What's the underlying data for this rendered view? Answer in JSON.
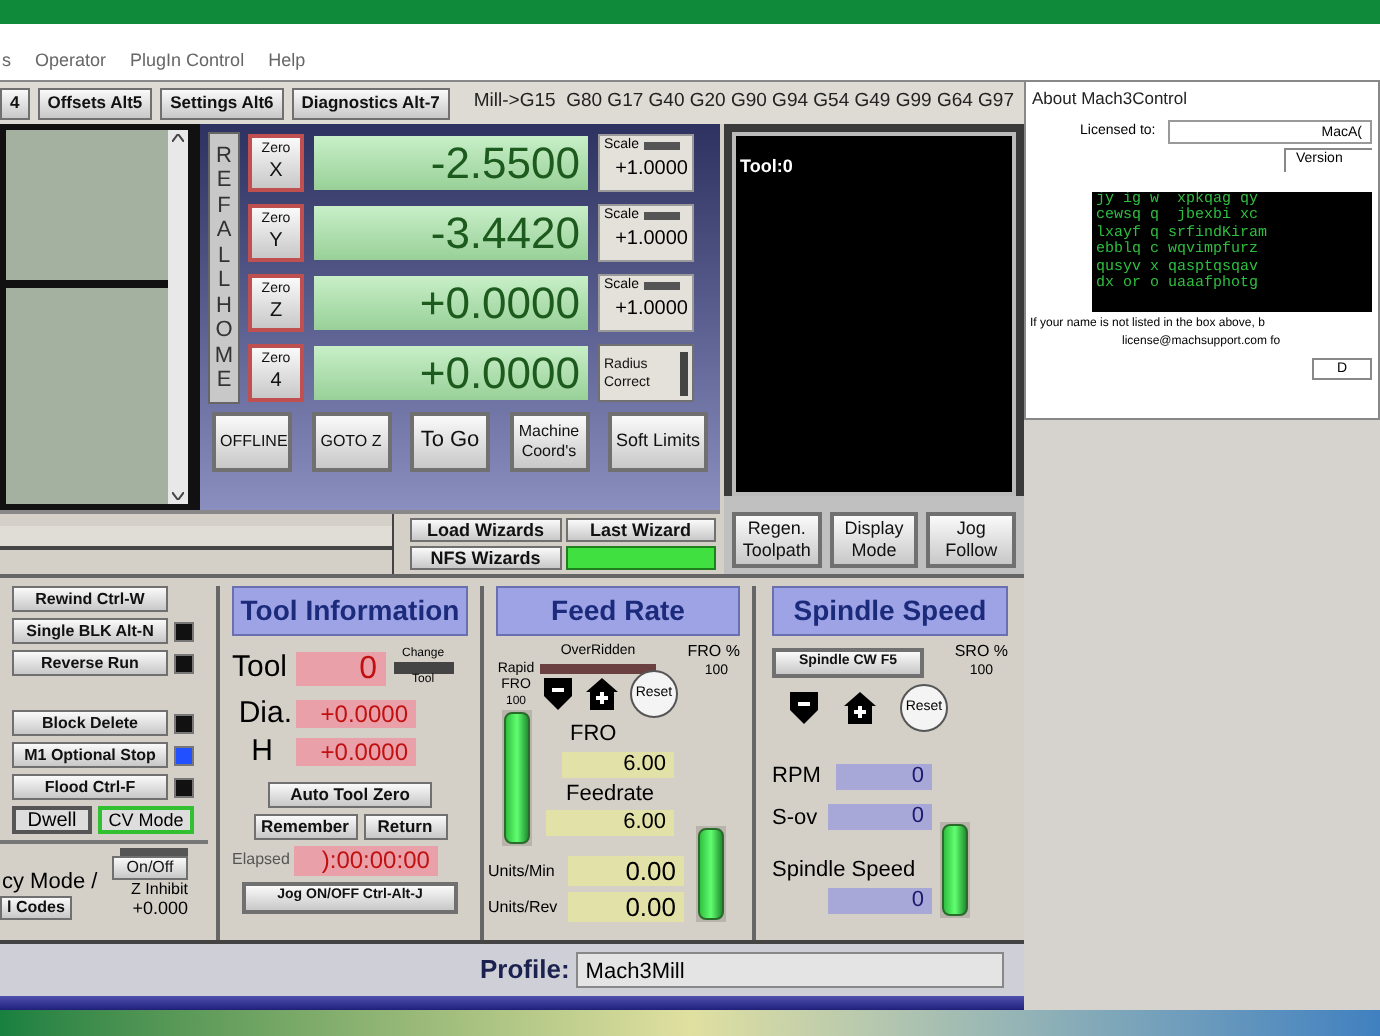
{
  "menu": [
    "s",
    "Operator",
    "PlugIn Control",
    "Help"
  ],
  "tabs": [
    {
      "label": "4",
      "selected": false
    },
    {
      "label": "Offsets Alt5",
      "selected": false
    },
    {
      "label": "Settings Alt6",
      "selected": false
    },
    {
      "label": "Diagnostics Alt-7",
      "selected": false
    }
  ],
  "modal_line": "Mill->G15  G80 G17 G40 G20 G90 G94 G54 G49 G99 G64 G97",
  "ref_all_home": "REFALLHOME",
  "axes": [
    {
      "zero_label": "Zero",
      "axis": "X",
      "value": "-2.5500",
      "side": {
        "kind": "scale",
        "label": "Scale",
        "value": "+1.0000"
      }
    },
    {
      "zero_label": "Zero",
      "axis": "Y",
      "value": "-3.4420",
      "side": {
        "kind": "scale",
        "label": "Scale",
        "value": "+1.0000"
      }
    },
    {
      "zero_label": "Zero",
      "axis": "Z",
      "value": "+0.0000",
      "side": {
        "kind": "scale",
        "label": "Scale",
        "value": "+1.0000"
      }
    },
    {
      "zero_label": "Zero",
      "axis": "4",
      "value": "+0.0000",
      "side": {
        "kind": "radius",
        "label": "Radius Correct"
      }
    }
  ],
  "dro_buttons": [
    "OFFLINE",
    "GOTO Z",
    "To Go",
    "Machine Coord's",
    "Soft Limits"
  ],
  "toolpath": {
    "label": "Tool:0",
    "buttons": [
      "Regen. Toolpath",
      "Display Mode",
      "Jog Follow"
    ]
  },
  "wizards": [
    "Load Wizards",
    "Last Wizard",
    "NFS Wizards"
  ],
  "left_buttons": [
    {
      "label": "Rewind Ctrl-W",
      "kind": "plain"
    },
    {
      "label": "Single BLK Alt-N",
      "kind": "led",
      "on": false
    },
    {
      "label": "Reverse Run",
      "kind": "led",
      "on": false
    },
    {
      "label": "Block Delete",
      "kind": "led",
      "on": false
    },
    {
      "label": "M1 Optional Stop",
      "kind": "led",
      "on": true
    },
    {
      "label": "Flood Ctrl-F",
      "kind": "led",
      "on": false
    }
  ],
  "dwell": {
    "label": "Dwell",
    "on": false
  },
  "cv_mode": {
    "label": "CV Mode",
    "on": true
  },
  "bottom_left": {
    "mode_text": "cy Mode /",
    "codes_button": "l Codes",
    "onoff_button": "On/Off",
    "z_inhibit": "Z Inhibit",
    "z_value": "+0.000"
  },
  "tool_info": {
    "title": "Tool Information",
    "tool_label": "Tool",
    "tool_value": "0",
    "change_label": "Change",
    "change_sub": "Tool",
    "dia_label": "Dia.",
    "dia_value": "+0.0000",
    "h_label": "H",
    "h_value": "+0.0000",
    "auto_zero": "Auto Tool Zero",
    "remember": "Remember",
    "return": "Return",
    "elapsed_label": "Elapsed",
    "elapsed_value": "):00:00:00",
    "jog": "Jog ON/OFF Ctrl-Alt-J"
  },
  "feed_rate": {
    "title": "Feed Rate",
    "overridden": "OverRidden",
    "fro_pct_label": "FRO %",
    "fro_pct": "100",
    "rapid_label": "Rapid FRO",
    "rapid_value": "100",
    "rapid_slider": {
      "level": 1
    },
    "feed_slider": {
      "level": 1
    },
    "reset": "Reset",
    "fro_label": "FRO",
    "fro_value": "6.00",
    "feedrate_label": "Feedrate",
    "feedrate_value": "6.00",
    "units_min_label": "Units/Min",
    "units_min": "0.00",
    "units_rev_label": "Units/Rev",
    "units_rev": "0.00"
  },
  "spindle": {
    "title": "Spindle Speed",
    "cw_button": "Spindle CW F5",
    "sro_label": "SRO %",
    "sro_value": "100",
    "reset": "Reset",
    "rpm_label": "RPM",
    "rpm": "0",
    "sov_label": "S-ov",
    "sov": "0",
    "speed_label": "Spindle Speed",
    "speed": "0",
    "slider": {
      "level": 1
    }
  },
  "profile": {
    "label": "Profile:",
    "value": "Mach3Mill"
  },
  "about_dialog": {
    "title": "About Mach3Control",
    "licensed_label": "Licensed to:",
    "licensed_value": "MacA(",
    "version_tab": "Version",
    "matrix_lines": [
      "jy ig w  xpkqag qy",
      "cewsq q  jbexbi xc",
      "lxayf q srfindKiram",
      "ebblq c wqvimpfurz",
      "qusyv x qasptqsqav",
      "dx or o uaaafphotg"
    ],
    "note": "If your name is not listed in the box above, b",
    "email": "license@machsupport.com fo",
    "button": "D"
  }
}
